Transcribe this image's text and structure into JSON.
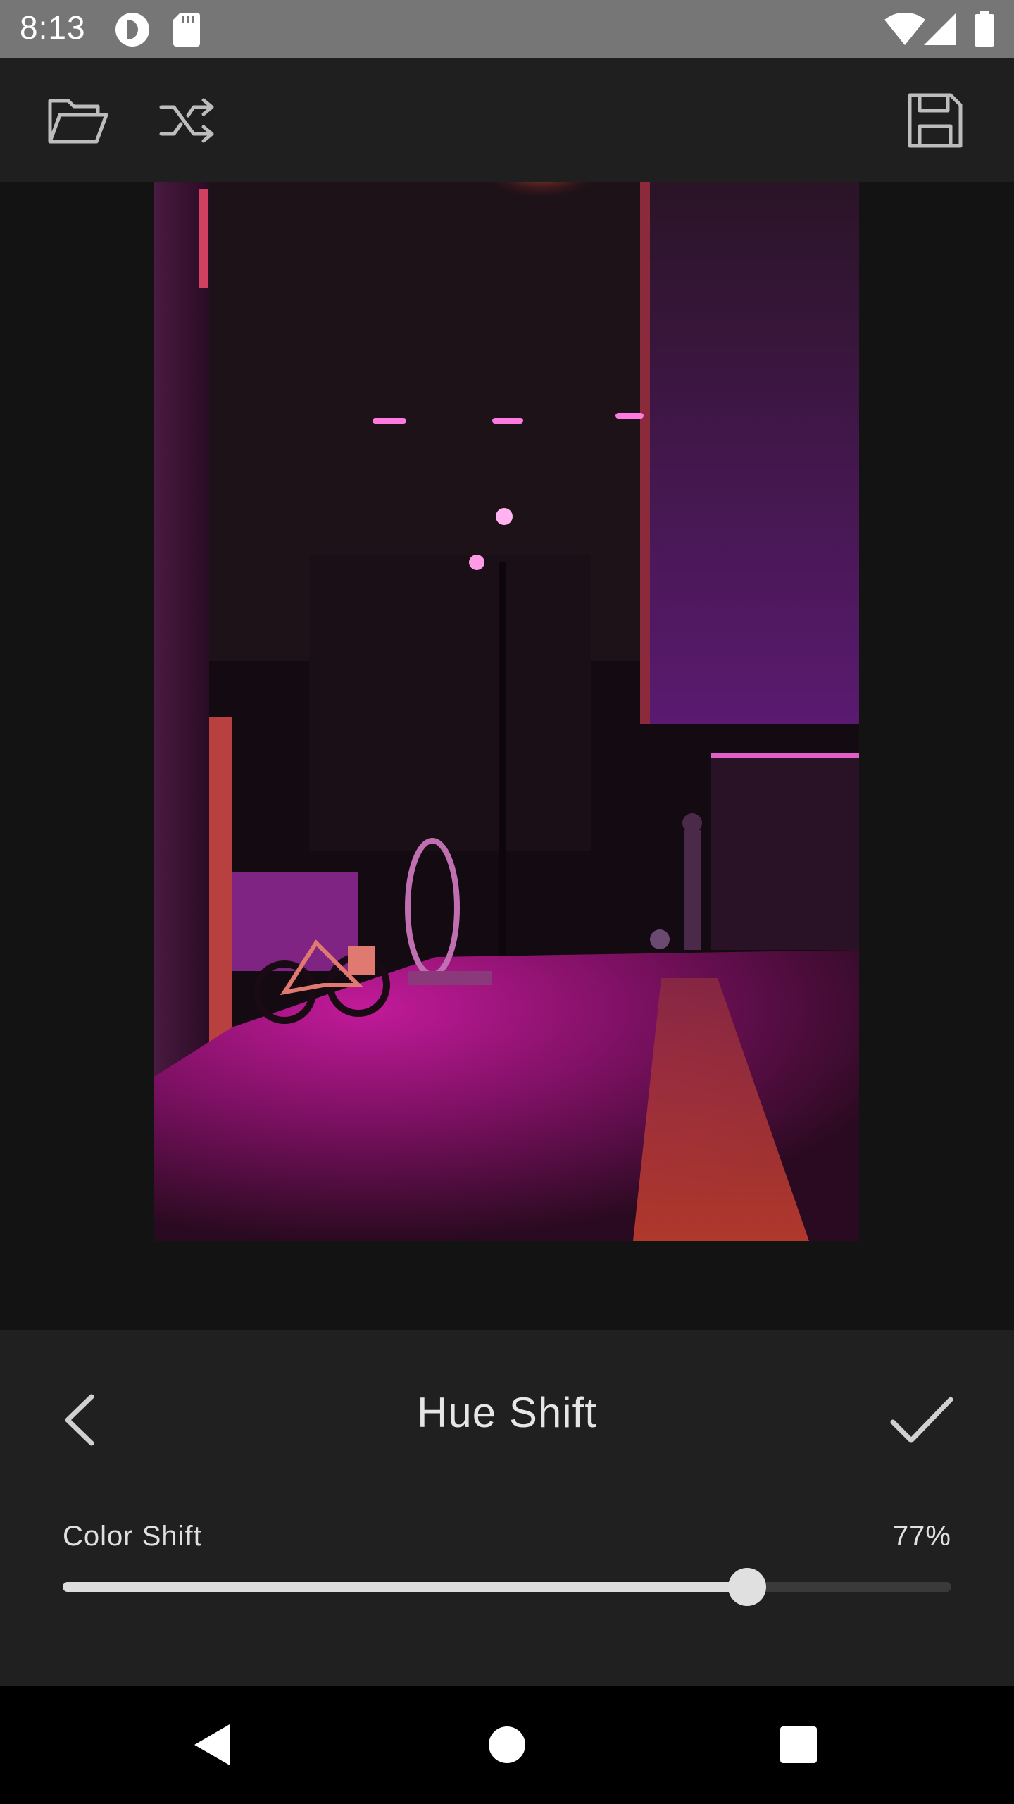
{
  "status_bar": {
    "time": "8:13",
    "icons": [
      "pocket-casts-icon",
      "sd-card-icon",
      "wifi-icon",
      "cell-signal-icon",
      "battery-icon"
    ]
  },
  "toolbar": {
    "icons": [
      "folder-open-icon",
      "shuffle-icon",
      "save-icon"
    ]
  },
  "panel": {
    "title": "Hue Shift",
    "back_icon": "chevron-left-icon",
    "confirm_icon": "check-icon",
    "slider": {
      "label": "Color Shift",
      "value_text": "77%",
      "value": 0.77
    }
  },
  "nav_bar": {
    "icons": [
      "back-triangle-icon",
      "home-circle-icon",
      "recents-square-icon"
    ]
  },
  "colors": {
    "status_bar_bg": "#767676",
    "toolbar_bg": "#1f1f1f",
    "canvas_bg": "#131313",
    "panel_bg": "#202020",
    "slider_fill": "#dedede",
    "slider_track": "#3a3a3a",
    "nav_bar_bg": "#000000"
  }
}
